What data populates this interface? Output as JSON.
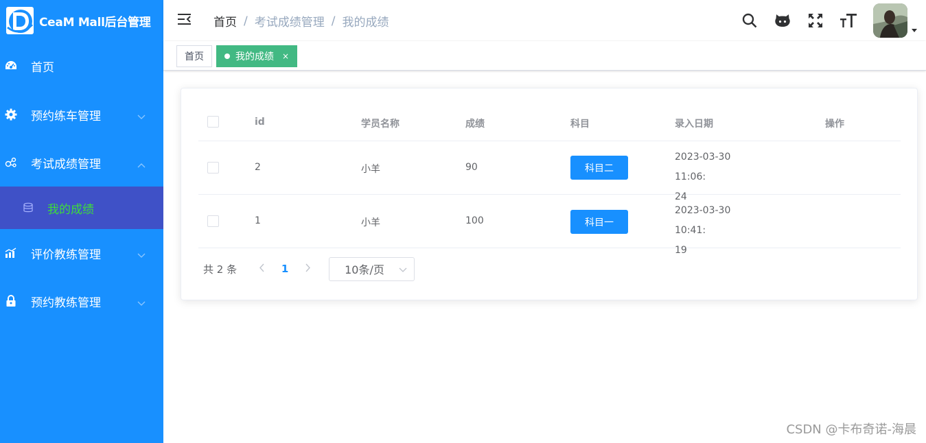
{
  "app": {
    "title": "CeaM Mall后台管理"
  },
  "colors": {
    "sidebar": "#1890ff",
    "submenu_active": "#3f51c7",
    "submenu_text": "#3ddc3a",
    "tag_active": "#42b983",
    "primary": "#1890ff"
  },
  "sidebar": {
    "items": [
      {
        "label": "首页",
        "icon": "dashboard-icon"
      },
      {
        "label": "预约练车管理",
        "icon": "gear-icon"
      },
      {
        "label": "考试成绩管理",
        "icon": "share-icon",
        "expanded": true
      },
      {
        "label": "评价教练管理",
        "icon": "chart-icon"
      },
      {
        "label": "预约教练管理",
        "icon": "lock-icon"
      }
    ],
    "sub_item": {
      "label": "我的成绩",
      "icon": "database-icon"
    }
  },
  "header": {
    "breadcrumb": [
      "首页",
      "考试成绩管理",
      "我的成绩"
    ],
    "icons": [
      "search-icon",
      "github-icon",
      "fullscreen-icon",
      "font-size-icon"
    ]
  },
  "tags": [
    {
      "label": "首页",
      "active": false
    },
    {
      "label": "我的成绩",
      "active": true,
      "close": "×"
    }
  ],
  "table": {
    "columns": [
      "id",
      "学员名称",
      "成绩",
      "科目",
      "录入日期",
      "操作"
    ],
    "rows": [
      {
        "id": "2",
        "name": "小羊",
        "score": "90",
        "subject": "科目二",
        "date_line1": "2023-03-30 11:06:",
        "date_line2": "24"
      },
      {
        "id": "1",
        "name": "小羊",
        "score": "100",
        "subject": "科目一",
        "date_line1": "2023-03-30 10:41:",
        "date_line2": "19"
      }
    ]
  },
  "pagination": {
    "total": "共 2 条",
    "current": "1",
    "page_size": "10条/页"
  },
  "watermark": "CSDN @卡布奇诺-海晨"
}
